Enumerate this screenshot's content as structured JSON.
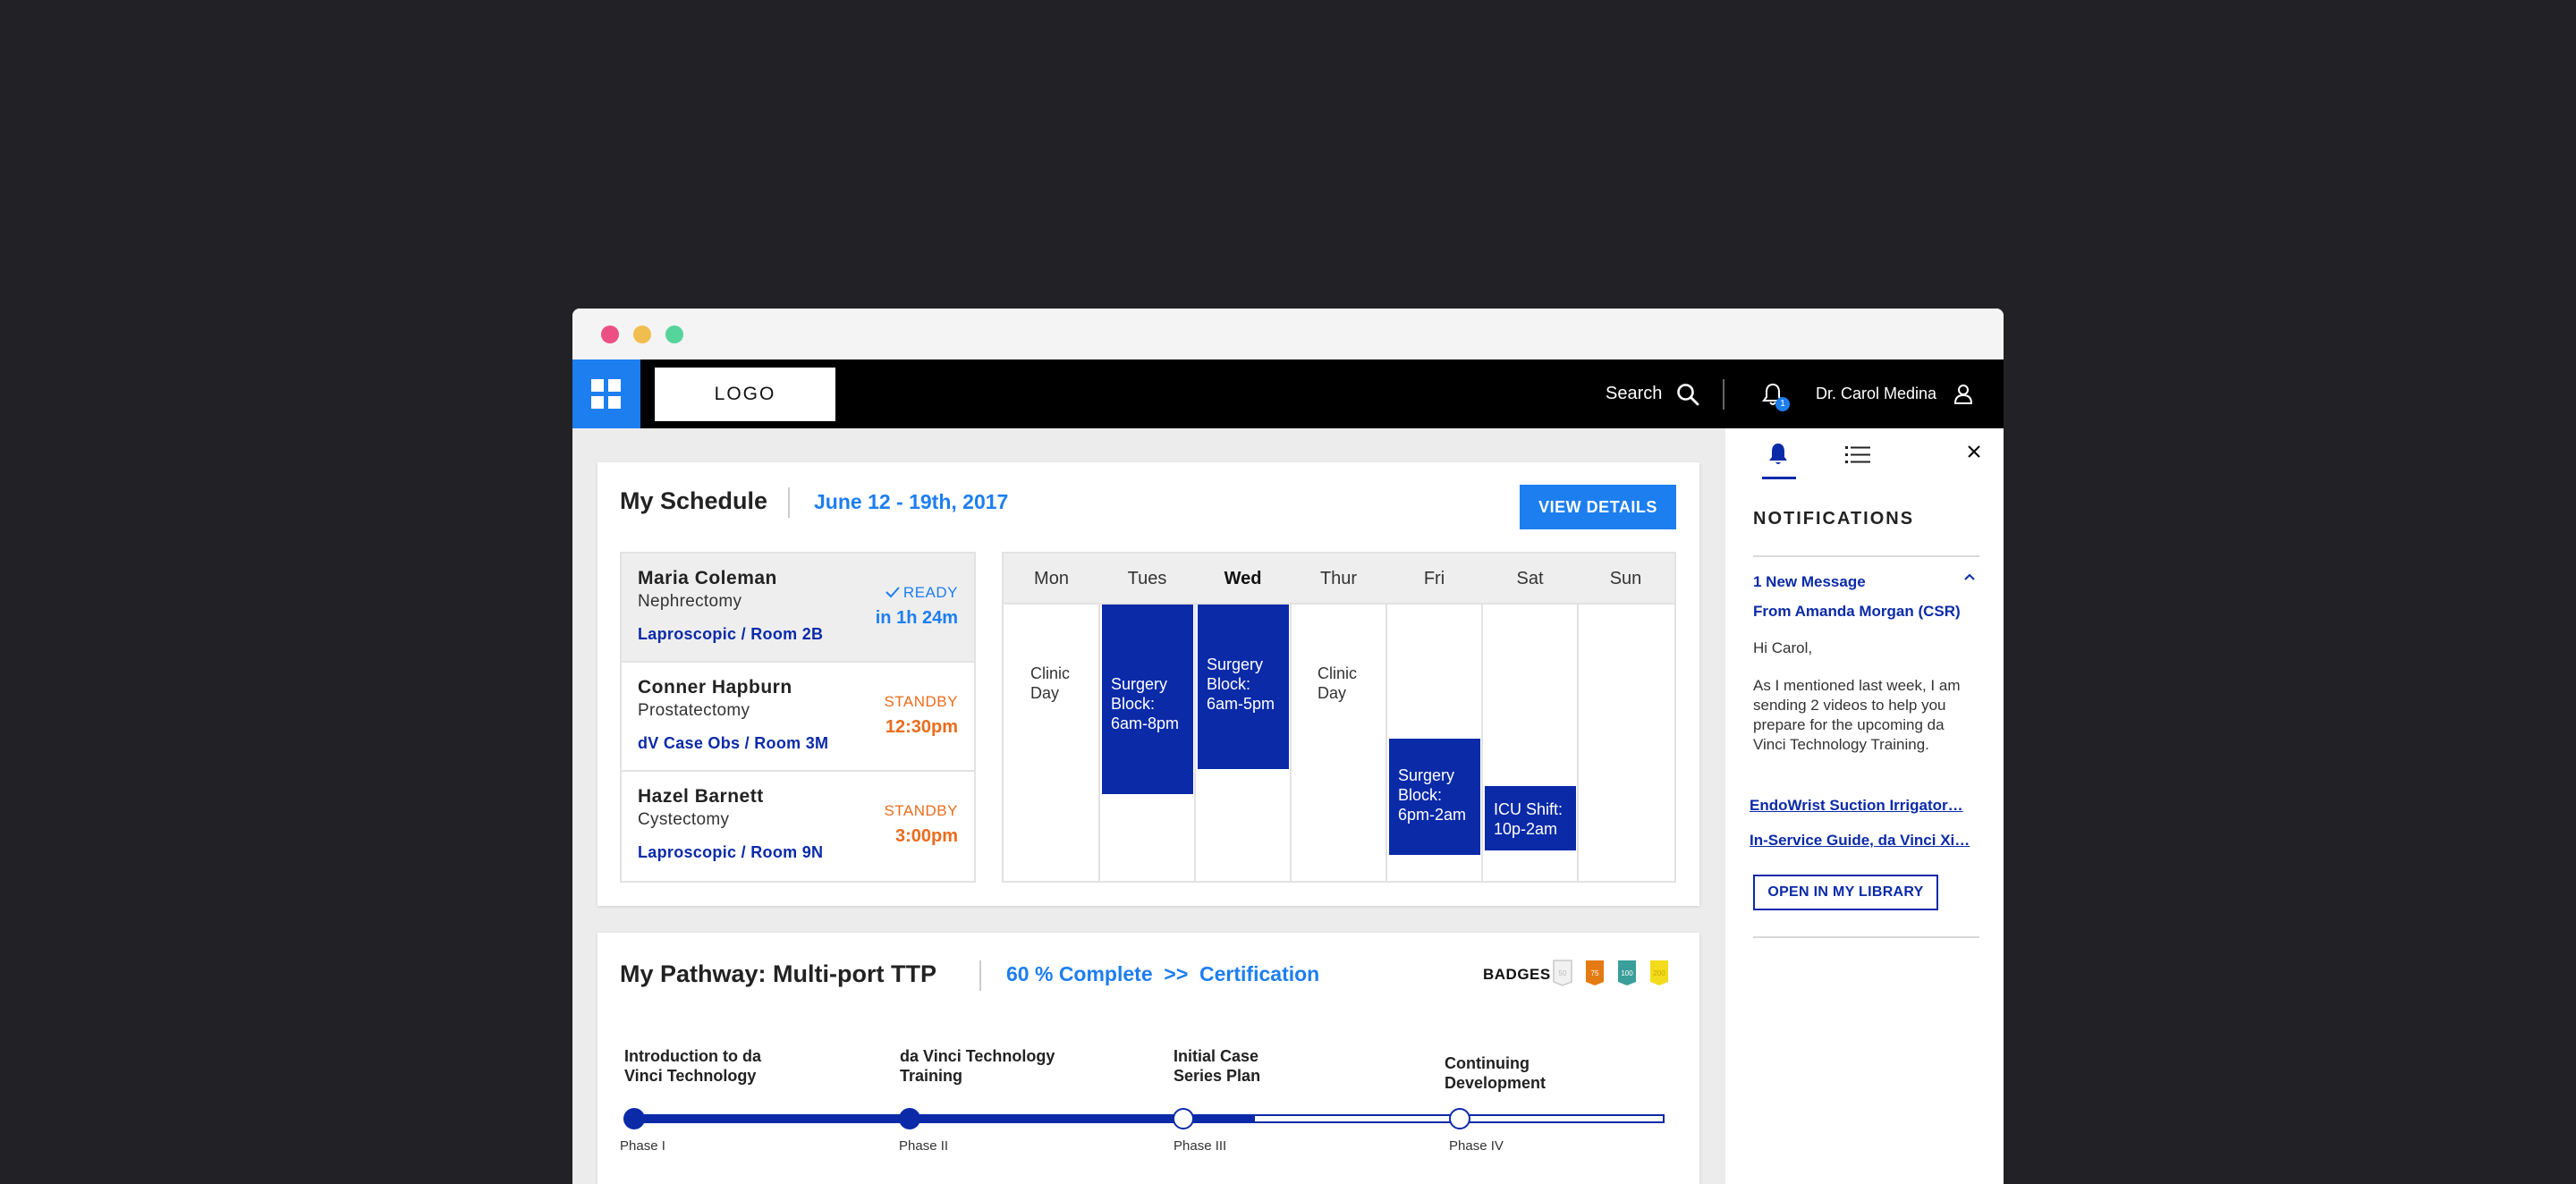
{
  "header": {
    "logo": "LOGO",
    "search_label": "Search",
    "notification_count": "1",
    "user_name": "Dr. Carol Medina"
  },
  "schedule": {
    "title": "My Schedule",
    "date_range": "June 12 - 19th, 2017",
    "view_details_label": "VIEW DETAILS",
    "appointments": [
      {
        "name": "Maria Coleman",
        "procedure": "Nephrectomy",
        "room": "Laproscopic / Room 2B",
        "status": "READY",
        "time": "in 1h 24m",
        "status_color": "#1d7ef0"
      },
      {
        "name": "Conner Hapburn",
        "procedure": "Prostatectomy",
        "room": "dV Case Obs / Room 3M",
        "status": "STANDBY",
        "time": "12:30pm",
        "status_color": "#ea6c1c"
      },
      {
        "name": "Hazel Barnett",
        "procedure": "Cystectomy",
        "room": "Laproscopic / Room 9N",
        "status": "STANDBY",
        "time": "3:00pm",
        "status_color": "#ea6c1c"
      }
    ],
    "days": [
      "Mon",
      "Tues",
      "Wed",
      "Thur",
      "Fri",
      "Sat",
      "Sun"
    ],
    "today": "Wed",
    "events": {
      "mon": [
        "Clinic",
        "Day"
      ],
      "tues": [
        "Surgery",
        "Block:",
        "6am-8pm"
      ],
      "wed": [
        "Surgery",
        "Block:",
        "6am-5pm"
      ],
      "thur": [
        "Clinic",
        "Day"
      ],
      "fri": [
        "Surgery",
        "Block:",
        "6pm-2am"
      ],
      "sat": [
        "ICU Shift:",
        "10p-2am"
      ]
    }
  },
  "pathway": {
    "title": "My Pathway: Multi-port TTP",
    "progress_text": "60 % Complete  >>  Certification",
    "progress": 0.6,
    "badges_label": "BADGES",
    "badges": [
      "50",
      "75",
      "100",
      "200"
    ],
    "phases": [
      {
        "title": [
          "Introduction to da",
          "Vinci Technology"
        ],
        "label": "Phase I"
      },
      {
        "title": [
          "da Vinci Technology",
          "Training"
        ],
        "label": "Phase II"
      },
      {
        "title": [
          "Initial Case",
          "Series Plan"
        ],
        "label": "Phase III"
      },
      {
        "title": [
          "Continuing",
          "Development"
        ],
        "label": "Phase IV"
      }
    ]
  },
  "notifications": {
    "title": "NOTIFICATIONS",
    "new_message": "1 New Message",
    "from": "From Amanda Morgan (CSR)",
    "greeting": "Hi Carol,",
    "body": "As I mentioned last week, I am sending 2 videos to help you prepare for the upcoming da Vinci Technology Training.",
    "links": [
      "EndoWrist Suction Irrigator…",
      "In-Service Guide, da Vinci Xi…"
    ],
    "open_button": "OPEN IN MY LIBRARY"
  },
  "colors": {
    "accent": "#1d7ef0",
    "navy": "#0b2aa8",
    "standby": "#ea6c1c"
  }
}
